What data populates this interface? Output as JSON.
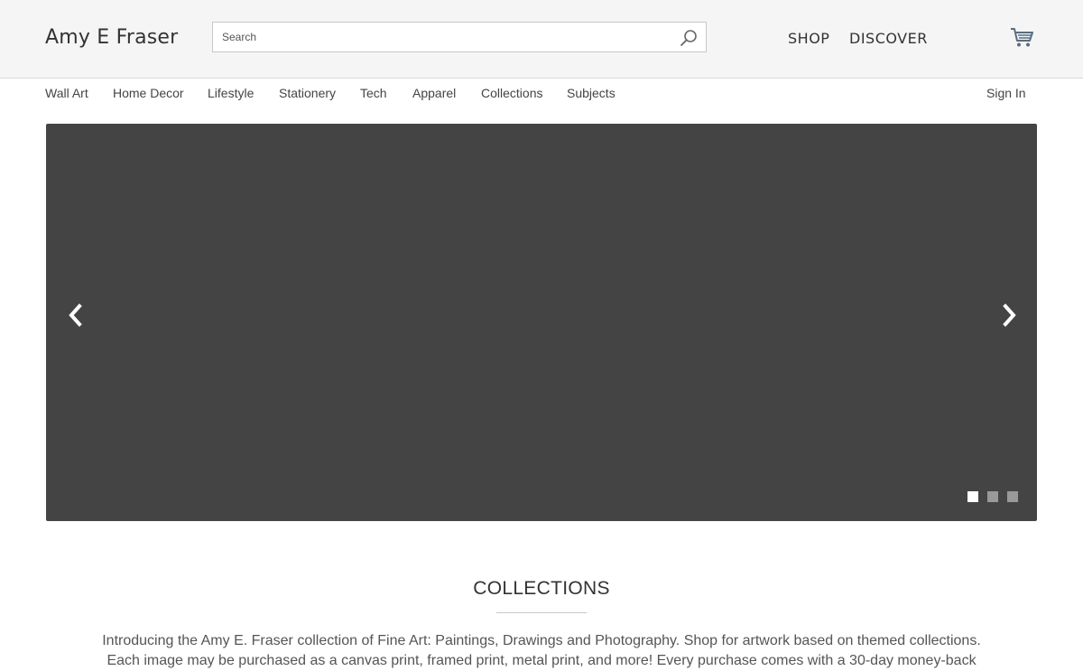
{
  "header": {
    "brand": "Amy E Fraser",
    "search_placeholder": "Search",
    "shop_label": "SHOP",
    "discover_label": "DISCOVER"
  },
  "subnav": {
    "items": [
      "Wall Art",
      "Home Decor",
      "Lifestyle",
      "Stationery",
      "Tech",
      "Apparel",
      "Collections",
      "Subjects"
    ],
    "sign_in": "Sign In"
  },
  "carousel": {
    "slide_count": 3,
    "active_slide": 1,
    "background_color": "#444444"
  },
  "collections": {
    "title": "COLLECTIONS",
    "text": "Introducing the Amy E. Fraser collection of Fine Art: Paintings, Drawings and Photography. Shop for artwork based on themed collections. Each image may be purchased as a canvas print, framed print, metal print, and more! Every purchase comes with a 30-day money-back"
  },
  "colors": {
    "header_bg": "#f5f5f5",
    "icon": "#5a6d80"
  },
  "icons": {
    "search": "search-icon",
    "cart": "cart-icon",
    "prev": "chevron-left-icon",
    "next": "chevron-right-icon"
  }
}
